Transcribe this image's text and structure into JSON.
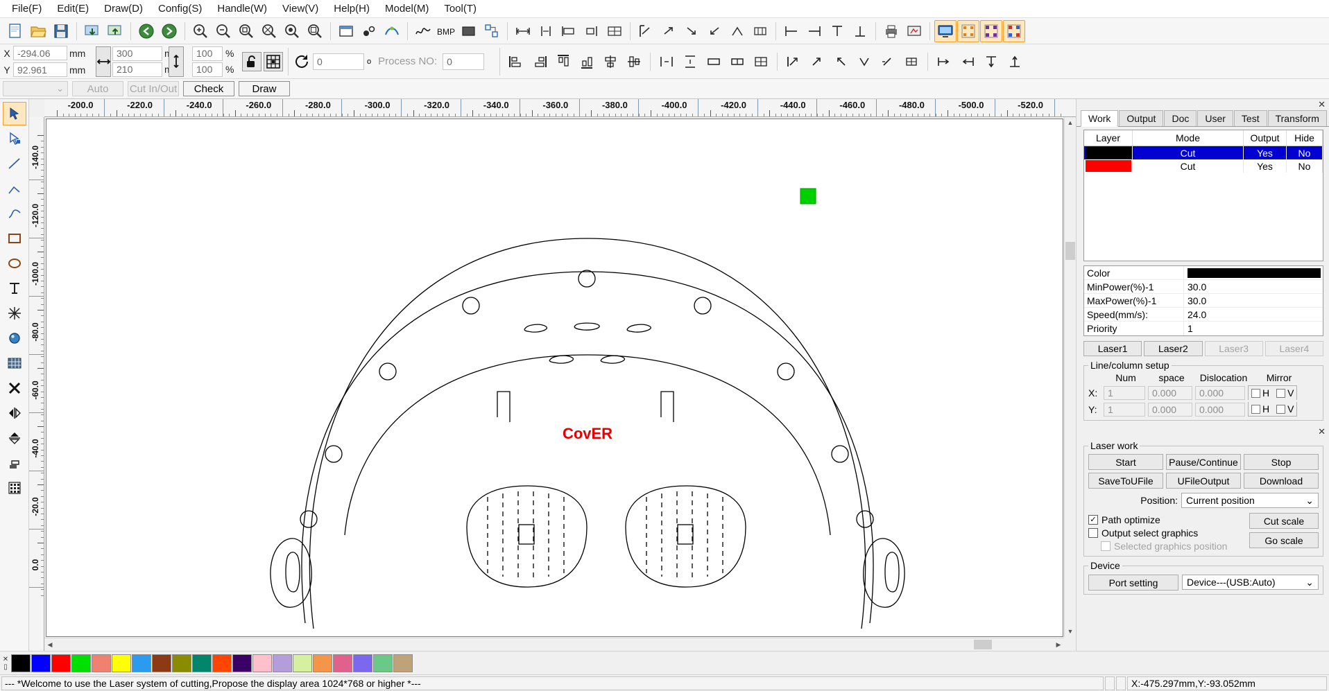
{
  "menu": {
    "items": [
      {
        "label": "File(F)",
        "name": "menu-file"
      },
      {
        "label": "Edit(E)",
        "name": "menu-edit"
      },
      {
        "label": "Draw(D)",
        "name": "menu-draw"
      },
      {
        "label": "Config(S)",
        "name": "menu-config"
      },
      {
        "label": "Handle(W)",
        "name": "menu-handle"
      },
      {
        "label": "View(V)",
        "name": "menu-view"
      },
      {
        "label": "Help(H)",
        "name": "menu-help"
      },
      {
        "label": "Model(M)",
        "name": "menu-model"
      },
      {
        "label": "Tool(T)",
        "name": "menu-tool"
      }
    ]
  },
  "toolbar": {
    "icons": [
      "new-file-icon",
      "open-file-icon",
      "save-file-icon",
      "import-icon",
      "export-icon",
      "undo-icon",
      "redo-icon",
      "zoom-in-icon",
      "zoom-out-icon",
      "zoom-out-step-icon",
      "zoom-fit-icon",
      "zoom-selection-icon",
      "zoom-page-icon",
      "zoom-window-icon",
      "rect-preview-icon",
      "node-edit-icon",
      "curve-smooth-icon",
      "curve-icon",
      "bmp-icon",
      "fill-icon",
      "offset-icon",
      "measure-icon",
      "array-icon",
      "align-left-icon",
      "align-right-icon",
      "print-icon",
      "preview-icon",
      "screen-icon",
      "marker1-icon",
      "marker2-icon",
      "marker3-icon"
    ],
    "bmp_label": "BMP"
  },
  "coords": {
    "x_label": "X",
    "y_label": "Y",
    "x_value": "-294.06",
    "y_value": "92.961",
    "unit": "mm",
    "width_value": "300",
    "height_value": "210",
    "width_unit": "mm",
    "height_unit": "mm",
    "scale_x": "100",
    "scale_y": "100",
    "percent": "%",
    "rotate_value": "0",
    "degree": "o",
    "process_no_label": "Process NO:",
    "process_no_value": "0",
    "width_icon": "horizontal-resize-icon",
    "height_icon": "vertical-resize-icon",
    "lock_icon": "unlock-icon",
    "grid_icon": "anchor-grid-icon",
    "rotate_icon": "rotate-icon"
  },
  "row3": {
    "combo_value": "",
    "auto_label": "Auto",
    "cut_in_out_label": "Cut In/Out",
    "check_label": "Check",
    "draw_label": "Draw"
  },
  "lefttools": {
    "items": [
      {
        "name": "select-tool",
        "icon": "arrow-select-icon",
        "selected": true
      },
      {
        "name": "node-edit-tool",
        "icon": "node-arrow-icon",
        "selected": false
      },
      {
        "name": "line-tool",
        "icon": "line-icon",
        "selected": false
      },
      {
        "name": "polyline-tool",
        "icon": "polyline-icon",
        "selected": false
      },
      {
        "name": "bezier-tool",
        "icon": "bezier-icon",
        "selected": false
      },
      {
        "name": "rectangle-tool",
        "icon": "rectangle-icon",
        "selected": false
      },
      {
        "name": "ellipse-tool",
        "icon": "ellipse-icon",
        "selected": false
      },
      {
        "name": "text-tool",
        "icon": "text-icon",
        "selected": false
      },
      {
        "name": "star-tool",
        "icon": "star-icon",
        "selected": false
      },
      {
        "name": "capture-tool",
        "icon": "camera-icon",
        "selected": false
      },
      {
        "name": "array-tool",
        "icon": "grid-array-icon",
        "selected": false
      },
      {
        "name": "delete-tool",
        "icon": "close-x-icon",
        "selected": false
      },
      {
        "name": "mirror-h-tool",
        "icon": "mirror-horizontal-icon",
        "selected": false
      },
      {
        "name": "mirror-v-tool",
        "icon": "mirror-vertical-icon",
        "selected": false
      },
      {
        "name": "offset-tool",
        "icon": "offset-layer-icon",
        "selected": false
      },
      {
        "name": "dot-array-tool",
        "icon": "dot-grid-icon",
        "selected": false
      }
    ]
  },
  "ruler": {
    "h_labels": [
      "-200.0",
      "-220.0",
      "-240.0",
      "-260.0",
      "-280.0",
      "-300.0",
      "-320.0",
      "-340.0",
      "-360.0",
      "-380.0",
      "-400.0",
      "-420.0",
      "-440.0",
      "-460.0",
      "-480.0",
      "-500.0",
      "-520.0"
    ],
    "v_labels": [
      "-140.0",
      "-120.0",
      "-100.0",
      "-80.0",
      "-60.0",
      "-40.0",
      "-20.0",
      "0.0"
    ]
  },
  "canvas": {
    "text_label": "CovER",
    "text_color": "#e80000",
    "marker_color": "#00d000"
  },
  "right": {
    "close_icon": "close-icon",
    "tabs": [
      {
        "label": "Work",
        "selected": true
      },
      {
        "label": "Output",
        "selected": false
      },
      {
        "label": "Doc",
        "selected": false
      },
      {
        "label": "User",
        "selected": false
      },
      {
        "label": "Test",
        "selected": false
      },
      {
        "label": "Transform",
        "selected": false
      }
    ],
    "layer_table": {
      "headers": [
        "Layer",
        "Mode",
        "Output",
        "Hide"
      ],
      "rows": [
        {
          "color": "#000000",
          "mode": "Cut",
          "output": "Yes",
          "hide": "No",
          "selected": true
        },
        {
          "color": "#ff0000",
          "mode": "Cut",
          "output": "Yes",
          "hide": "No",
          "selected": false
        }
      ]
    },
    "params": [
      {
        "key": "Color",
        "value": "",
        "swatch": "#000000"
      },
      {
        "key": "MinPower(%)-1",
        "value": "30.0"
      },
      {
        "key": "MaxPower(%)-1",
        "value": "30.0"
      },
      {
        "key": "Speed(mm/s):",
        "value": "24.0"
      },
      {
        "key": "Priority",
        "value": "1"
      }
    ],
    "lasers": [
      {
        "label": "Laser1",
        "enabled": true
      },
      {
        "label": "Laser2",
        "enabled": true
      },
      {
        "label": "Laser3",
        "enabled": false
      },
      {
        "label": "Laser4",
        "enabled": false
      }
    ],
    "linecolumn": {
      "legend": "Line/column setup",
      "headers": [
        "Num",
        "space",
        "Dislocation",
        "Mirror"
      ],
      "x_label": "X:",
      "y_label": "Y:",
      "x_num": "1",
      "x_space": "0.000",
      "x_dislocation": "0.000",
      "y_num": "1",
      "y_space": "0.000",
      "y_dislocation": "0.000",
      "mirror_h": "H",
      "mirror_v": "V"
    },
    "laserwork": {
      "legend": "Laser work",
      "buttons": [
        "Start",
        "Pause/Continue",
        "Stop",
        "SaveToUFile",
        "UFileOutput",
        "Download"
      ],
      "position_label": "Position:",
      "position_value": "Current position",
      "path_optimize": "Path optimize",
      "path_optimize_checked": true,
      "output_select_graphics": "Output select graphics",
      "output_select_checked": false,
      "selected_graphics_position": "Selected graphics position",
      "selected_graphics_enabled": false,
      "cut_scale": "Cut scale",
      "go_scale": "Go scale"
    },
    "device": {
      "legend": "Device",
      "port_setting": "Port setting",
      "device_value": "Device---(USB:Auto)"
    }
  },
  "palette": {
    "close_icon": "close-icon",
    "colors": [
      "#000000",
      "#0000ff",
      "#ff0000",
      "#00e000",
      "#f08070",
      "#ffff00",
      "#2b9bf0",
      "#8b3a13",
      "#8b8b00",
      "#00846a",
      "#ff4500",
      "#3a0066",
      "#ffc0cb",
      "#b39ddb",
      "#d4f0a0",
      "#f4954a",
      "#e0628c",
      "#7b68ee",
      "#6ac987",
      "#bda377"
    ]
  },
  "status": {
    "message": "--- *Welcome to use the Laser system of cutting,Propose the display area 1024*768 or higher *---",
    "coordinate": "X:-475.297mm,Y:-93.052mm"
  }
}
